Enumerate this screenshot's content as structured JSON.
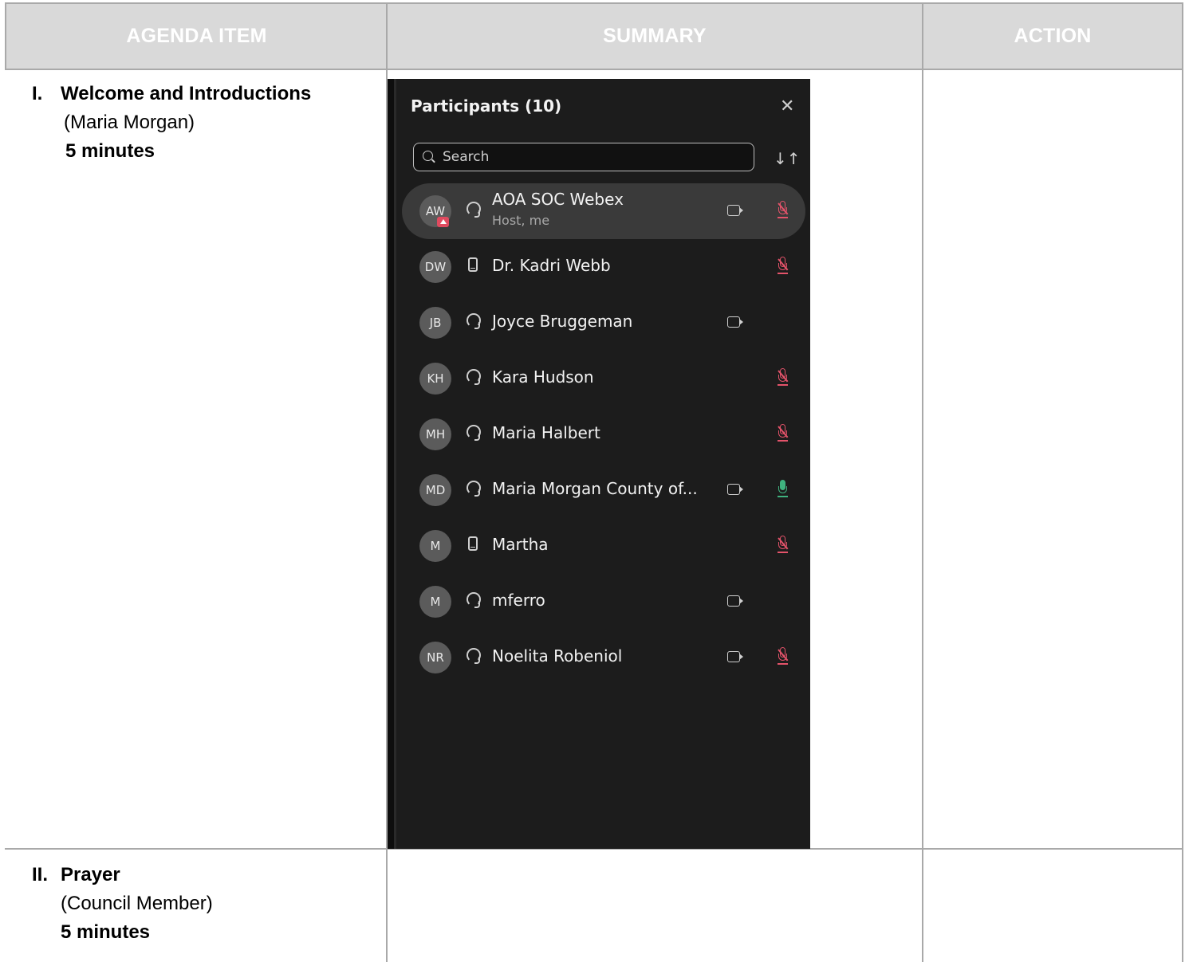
{
  "headers": {
    "agenda": "AGENDA ITEM",
    "summary": "SUMMARY",
    "action": "ACTION"
  },
  "items": [
    {
      "num": "I.",
      "title": "Welcome and Introductions",
      "who": "(Maria Morgan)",
      "duration": "5 minutes"
    },
    {
      "num": "II.",
      "title": "Prayer",
      "who": "(Council Member)",
      "duration": "5 minutes"
    }
  ],
  "panel": {
    "title": "Participants (10)",
    "close_icon": "close-icon",
    "search_placeholder": "Search",
    "sort_icon": "sort-icon",
    "participants": [
      {
        "initials": "AW",
        "name": "AOA SOC Webex",
        "role": "Host, me",
        "device": "headset",
        "video": true,
        "mic": "muted",
        "sharing": true
      },
      {
        "initials": "DW",
        "name": "Dr. Kadri Webb",
        "device": "phone",
        "video": false,
        "mic": "muted"
      },
      {
        "initials": "JB",
        "name": "Joyce Bruggeman",
        "device": "headset",
        "video": true,
        "mic": "none"
      },
      {
        "initials": "KH",
        "name": "Kara Hudson",
        "device": "headset",
        "video": false,
        "mic": "muted"
      },
      {
        "initials": "MH",
        "name": "Maria Halbert",
        "device": "headset",
        "video": false,
        "mic": "muted"
      },
      {
        "initials": "MD",
        "name": "Maria Morgan County of...",
        "device": "headset",
        "video": true,
        "mic": "on"
      },
      {
        "initials": "M",
        "name": "Martha",
        "device": "phone",
        "video": false,
        "mic": "muted"
      },
      {
        "initials": "M",
        "name": "mferro",
        "device": "headset",
        "video": true,
        "mic": "none"
      },
      {
        "initials": "NR",
        "name": "Noelita Robeniol",
        "device": "headset",
        "video": true,
        "mic": "muted"
      }
    ]
  },
  "colors": {
    "muted_mic": "#e3536a",
    "active_mic": "#3fb37f",
    "panel_bg": "#1c1c1c",
    "header_bg": "#d9d9d9"
  }
}
